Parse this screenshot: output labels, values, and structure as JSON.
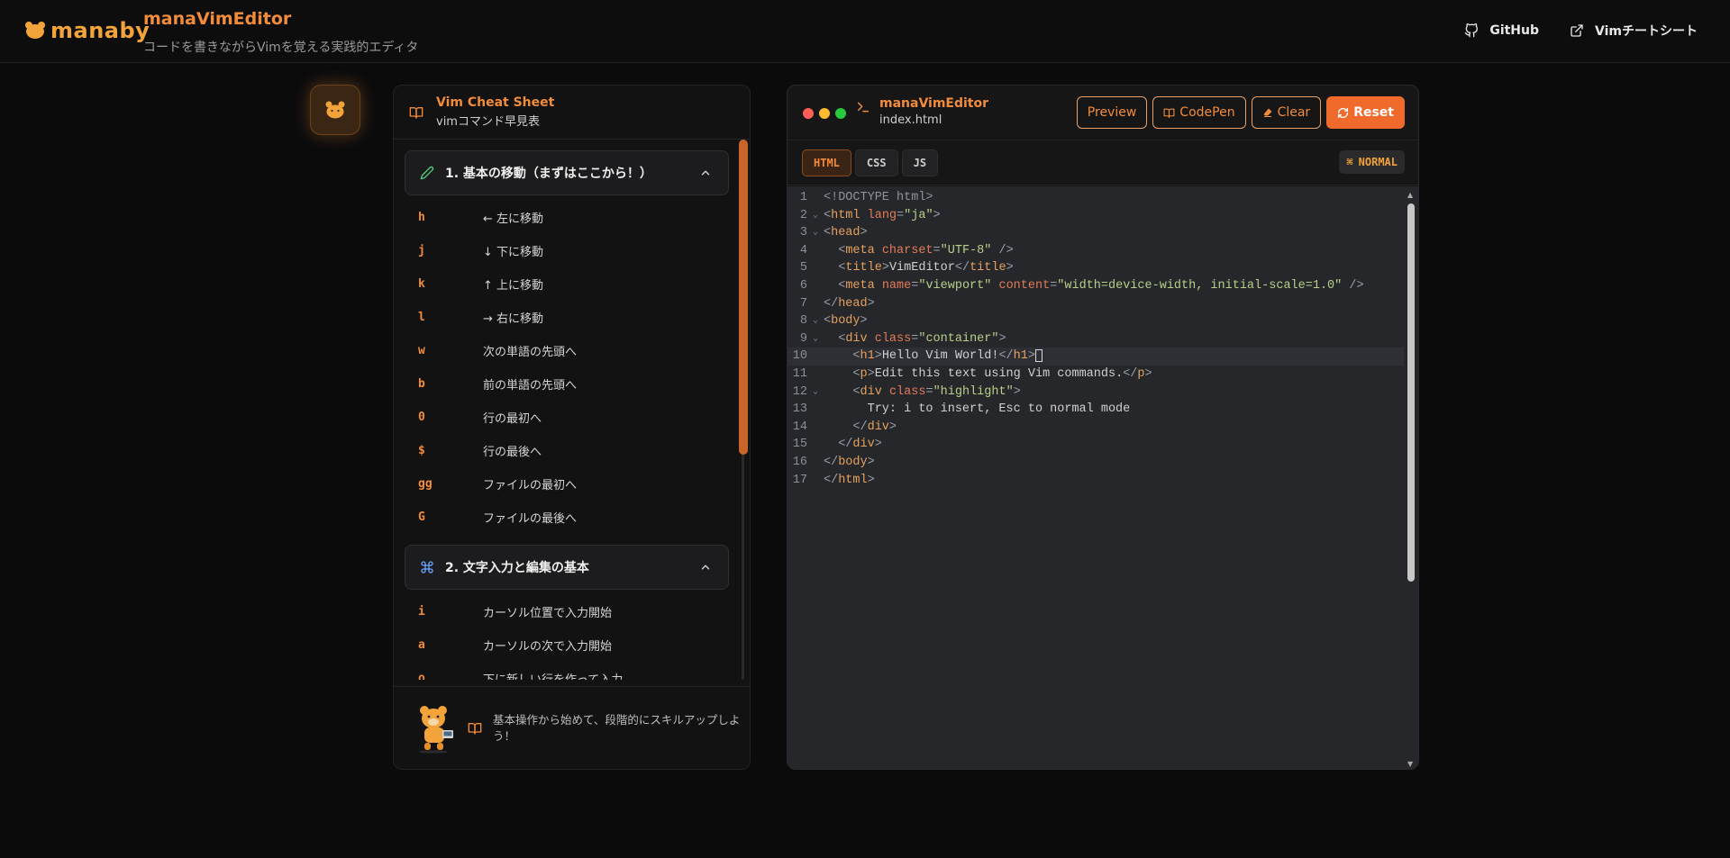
{
  "header": {
    "logo_text": "manaby",
    "app_title": "manaVimEditor",
    "app_subtitle": "コードを書きながらVimを覚える実践的エディタ",
    "nav": [
      {
        "label": "GitHub",
        "icon": "github-icon"
      },
      {
        "label": "Vimチートシート",
        "icon": "external-link-icon"
      }
    ]
  },
  "cheat_sheet": {
    "title": "Vim Cheat Sheet",
    "subtitle": "vimコマンド早見表",
    "sections": [
      {
        "label": "1. 基本の移動（まずはここから！）",
        "icon": "pencil-icon",
        "expanded": true,
        "items": [
          {
            "key": "h",
            "desc": "← 左に移動"
          },
          {
            "key": "j",
            "desc": "↓ 下に移動"
          },
          {
            "key": "k",
            "desc": "↑ 上に移動"
          },
          {
            "key": "l",
            "desc": "→ 右に移動"
          },
          {
            "key": "w",
            "desc": "次の単語の先頭へ"
          },
          {
            "key": "b",
            "desc": "前の単語の先頭へ"
          },
          {
            "key": "0",
            "desc": "行の最初へ"
          },
          {
            "key": "$",
            "desc": "行の最後へ"
          },
          {
            "key": "gg",
            "desc": "ファイルの最初へ"
          },
          {
            "key": "G",
            "desc": "ファイルの最後へ"
          }
        ]
      },
      {
        "label": "2. 文字入力と編集の基本",
        "icon": "command-icon",
        "expanded": true,
        "items": [
          {
            "key": "i",
            "desc": "カーソル位置で入力開始"
          },
          {
            "key": "a",
            "desc": "カーソルの次で入力開始"
          },
          {
            "key": "o",
            "desc": "下に新しい行を作って入力"
          }
        ]
      }
    ],
    "footer_tip": "基本操作から始めて、段階的にスキルアップしよう！"
  },
  "editor": {
    "name": "manaVimEditor",
    "file": "index.html",
    "buttons": {
      "preview": "Preview",
      "codepen": "CodePen",
      "clear": "Clear",
      "reset": "Reset"
    },
    "tabs": [
      {
        "label": "HTML",
        "active": true
      },
      {
        "label": "CSS",
        "active": false
      },
      {
        "label": "JS",
        "active": false
      }
    ],
    "mode": "NORMAL",
    "current_line": 10,
    "lines": [
      "<!DOCTYPE html>",
      "<html lang=\"ja\">",
      "<head>",
      "  <meta charset=\"UTF-8\" />",
      "  <title>VimEditor</title>",
      "  <meta name=\"viewport\" content=\"width=device-width, initial-scale=1.0\" />",
      "</head>",
      "<body>",
      "  <div class=\"container\">",
      "    <h1>Hello Vim World!</h1>",
      "    <p>Edit this text using Vim commands.</p>",
      "    <div class=\"highlight\">",
      "      Try: i to insert, Esc to normal mode",
      "    </div>",
      "  </div>",
      "</body>",
      "</html>"
    ]
  },
  "colors": {
    "accent": "#f28c3a",
    "reset_button": "#f06a2c",
    "background": "#0b0b0c",
    "editor_bg": "#25272b"
  }
}
